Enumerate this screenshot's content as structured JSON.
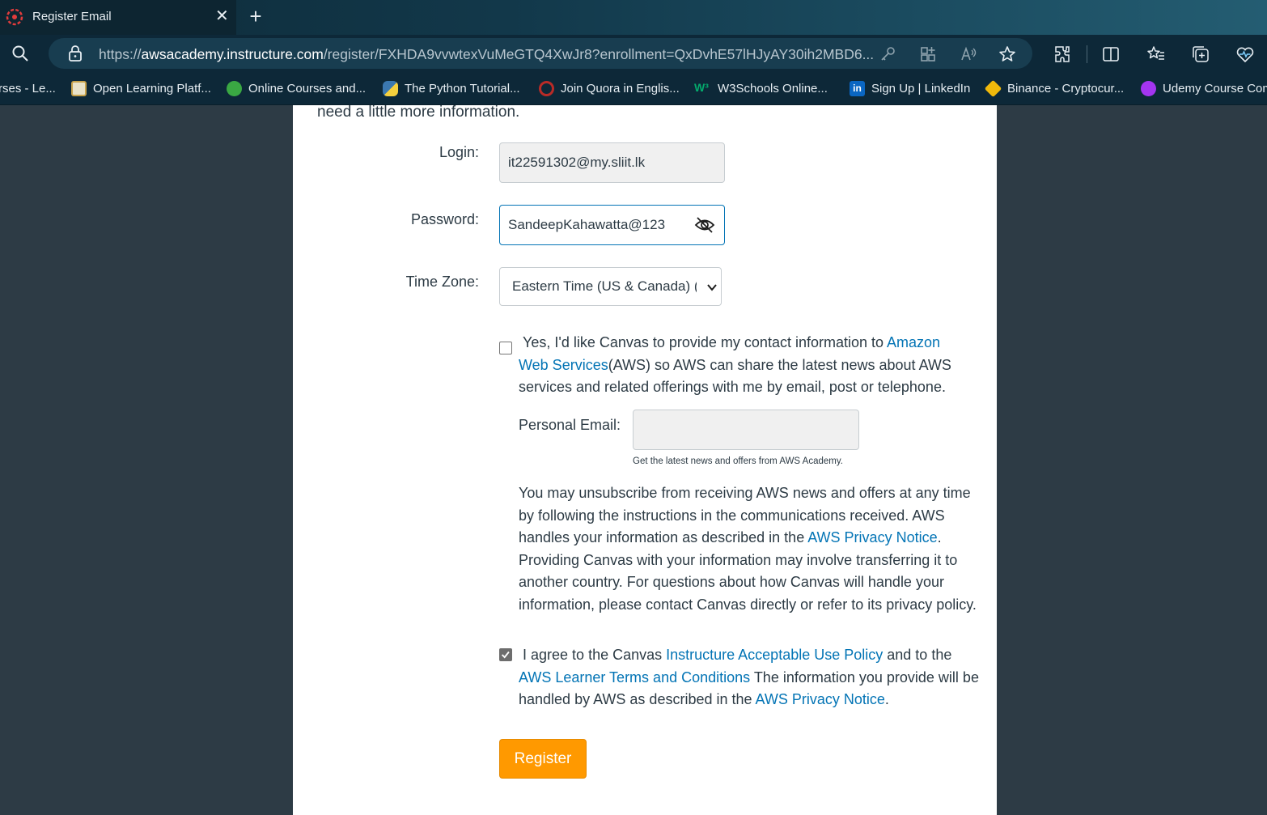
{
  "browser": {
    "tab_title": "Register Email",
    "url_scheme": "https://",
    "url_host": "awsacademy.instructure.com",
    "url_path": "/register/FXHDA9vvwtexVuMeGTQ4XwJr8?enrollment=QxDvhE57lHJyAY30ih2MBD6...",
    "bookmarks": [
      {
        "label": "rses - Le...",
        "icon": "course-icon",
        "color": "#0d2838"
      },
      {
        "label": "Open Learning Platf...",
        "icon": "open-learning-icon",
        "color": "#c8a24a"
      },
      {
        "label": "Online Courses and...",
        "icon": "online-courses-icon",
        "color": "#3aa843"
      },
      {
        "label": "The Python Tutorial...",
        "icon": "python-icon",
        "color": "#3b78b0"
      },
      {
        "label": "Join Quora in Englis...",
        "icon": "quora-icon",
        "color": "#b92b27"
      },
      {
        "label": "W3Schools Online...",
        "icon": "w3schools-icon",
        "color": "#04aa6d"
      },
      {
        "label": "Sign Up | LinkedIn",
        "icon": "linkedin-icon",
        "color": "#0a66c2"
      },
      {
        "label": "Binance - Cryptocur...",
        "icon": "binance-icon",
        "color": "#f0b90b"
      },
      {
        "label": "Udemy Course Com",
        "icon": "udemy-icon",
        "color": "#a435f0"
      }
    ]
  },
  "form": {
    "intro": "need a little more information.",
    "login_label": "Login:",
    "login_value": "it22591302@my.sliit.lk",
    "password_label": "Password:",
    "password_value": "SandeepKahawatta@123",
    "timezone_label": "Time Zone:",
    "timezone_value": "Eastern Time (US & Canada) (-",
    "consent_checked": false,
    "consent_pre": "Yes, I'd like Canvas to provide my contact information to ",
    "consent_link": "Amazon Web Services",
    "consent_post": "(AWS) so AWS can share the latest news about AWS services and related offerings with me by email, post or telephone.",
    "personal_email_label": "Personal Email:",
    "personal_email_value": "",
    "personal_email_note": "Get the latest news and offers from AWS Academy.",
    "unsub_pre": "You may unsubscribe from receiving AWS news and offers at any time by following the instructions in the communications received. AWS handles your information as described in the ",
    "unsub_link": "AWS Privacy Notice",
    "unsub_post": ". Providing Canvas with your information may involve transferring it to another country. For questions about how Canvas will handle your information, please contact Canvas directly or refer to its privacy policy.",
    "agree_checked": true,
    "agree_pre": "I agree to the Canvas ",
    "agree_link1": "Instructure Acceptable Use Policy",
    "agree_mid": " and to the ",
    "agree_link2": "AWS Learner Terms and Conditions",
    "agree_mid2": " The information you provide will be handled by AWS as described in the ",
    "agree_link3": "AWS Privacy Notice",
    "agree_end": ".",
    "register_label": "Register"
  },
  "colors": {
    "link": "#0374b5",
    "register_button": "#ff9900",
    "page_background": "#2d3b45"
  }
}
